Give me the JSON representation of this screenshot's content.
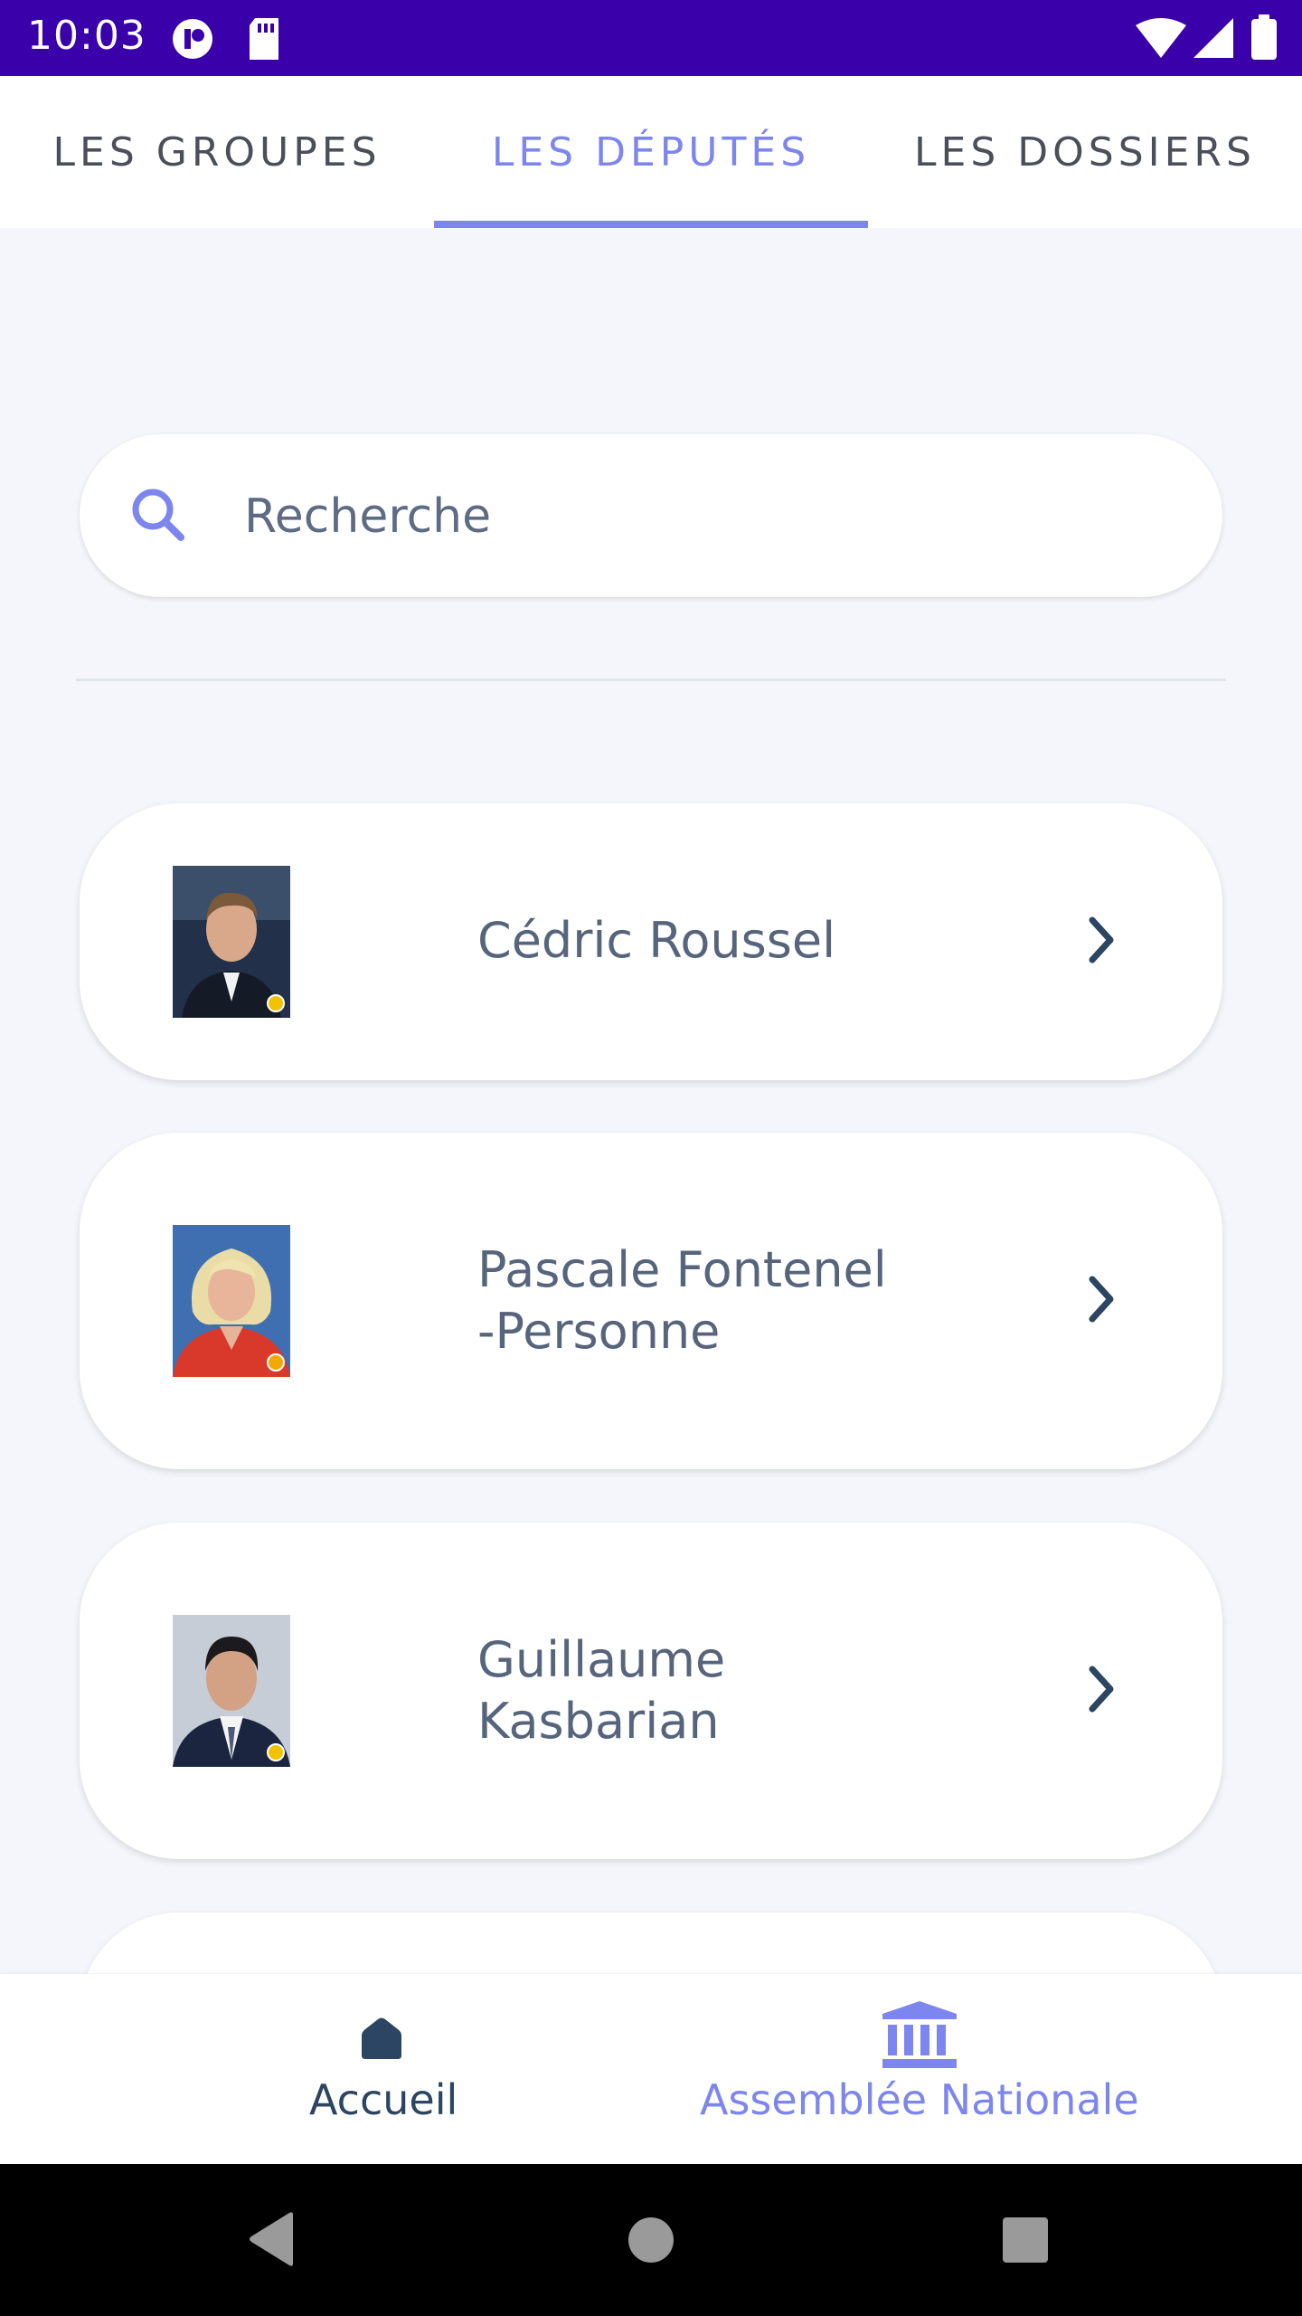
{
  "status_bar": {
    "time": "10:03"
  },
  "tabs": [
    {
      "label": "LES GROUPES"
    },
    {
      "label": "LES DÉPUTÉS",
      "active": true
    },
    {
      "label": "LES DOSSIERS"
    }
  ],
  "search": {
    "placeholder": "Recherche"
  },
  "deputies": [
    {
      "name": "Cédric Roussel",
      "photo_bg": "#1f2a3d"
    },
    {
      "name": "Pascale Fontenel-Personne",
      "name_line1": "Pascale Fontenel",
      "name_line2": "-Personne",
      "photo_bg": "#c23a2a"
    },
    {
      "name": "Guillaume Kasbarian",
      "name_line1": "Guillaume",
      "name_line2": "Kasbarian",
      "photo_bg": "#c9d0d8"
    }
  ],
  "bottom_nav": [
    {
      "label": "Accueil",
      "icon": "home-icon"
    },
    {
      "label": "Assemblée Nationale",
      "icon": "building-icon",
      "active": true
    }
  ],
  "colors": {
    "accent": "#7c86ee",
    "status_bar": "#3a00aa",
    "text_dark": "#2c4562",
    "text_muted": "#56647c",
    "background": "#f4f6fb"
  }
}
